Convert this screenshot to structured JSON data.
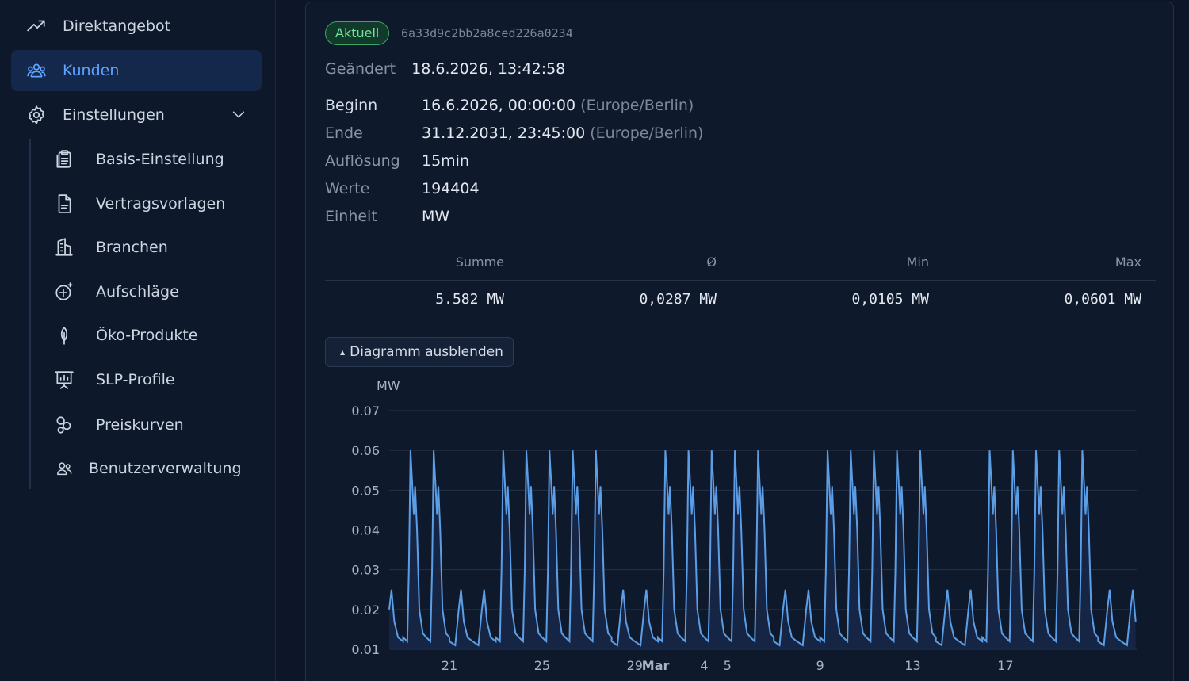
{
  "sidebar": {
    "items": [
      {
        "label": "Direktangebot",
        "icon": "trending-up-icon"
      },
      {
        "label": "Kunden",
        "icon": "users-icon",
        "active": true
      },
      {
        "label": "Einstellungen",
        "icon": "gear-icon",
        "expanded": true
      }
    ],
    "subitems": [
      {
        "label": "Basis-Einstellung",
        "icon": "clipboard-icon"
      },
      {
        "label": "Vertragsvorlagen",
        "icon": "document-icon"
      },
      {
        "label": "Branchen",
        "icon": "building-icon"
      },
      {
        "label": "Aufschläge",
        "icon": "plus-circle-icon"
      },
      {
        "label": "Öko-Produkte",
        "icon": "leaf-icon"
      },
      {
        "label": "SLP-Profile",
        "icon": "presentation-chart-icon"
      },
      {
        "label": "Preiskurven",
        "icon": "circles-icon"
      },
      {
        "label": "Benutzerverwaltung",
        "icon": "user-group-icon"
      }
    ]
  },
  "detail": {
    "badge": "Aktuell",
    "hash": "6a33d9c2bb2a8ced226a0234",
    "changed_label": "Geändert",
    "changed_value": "18.6.2026, 13:42:58",
    "fields": [
      {
        "label": "Beginn",
        "value": "16.6.2026, 00:00:00",
        "suffix": "(Europe/Berlin)"
      },
      {
        "label": "Ende",
        "value": "31.12.2031, 23:45:00",
        "suffix": "(Europe/Berlin)"
      },
      {
        "label": "Auflösung",
        "value": "15min",
        "suffix": ""
      },
      {
        "label": "Werte",
        "value": "194404",
        "suffix": ""
      },
      {
        "label": "Einheit",
        "value": "MW",
        "suffix": ""
      }
    ],
    "stats": {
      "headers": [
        "Summe",
        "Ø",
        "Min",
        "Max"
      ],
      "values": [
        "5.582 MW",
        "0,0287 MW",
        "0,0105 MW",
        "0,0601 MW"
      ]
    },
    "toggle_label": "Diagramm ausblenden"
  },
  "colors": {
    "line": "#5b9ee6",
    "fill": "#16284a",
    "grid": "#263248"
  },
  "chart_data": {
    "type": "area",
    "ylabel": "MW",
    "ylim": [
      0.01,
      0.07
    ],
    "yticks": [
      0.01,
      0.02,
      0.03,
      0.04,
      0.05,
      0.06,
      0.07
    ],
    "xlim": [
      18.4,
      50.7
    ],
    "xticks": [
      {
        "label": "21",
        "day": 21
      },
      {
        "label": "25",
        "day": 25
      },
      {
        "label": "29",
        "day": 29
      },
      {
        "label": "Mar",
        "day": 29.9,
        "bold": true
      },
      {
        "label": "4",
        "day": 32
      },
      {
        "label": "5",
        "day": 33
      },
      {
        "label": "9",
        "day": 37
      },
      {
        "label": "13",
        "day": 41
      },
      {
        "label": "17",
        "day": 45
      }
    ],
    "x_unit": "days (Feb/Mar)",
    "series": [
      {
        "daily_pattern": [
          {
            "day": 18,
            "kind": "weekend"
          },
          {
            "day": 19,
            "kind": "weekday"
          },
          {
            "day": 20,
            "kind": "weekday"
          },
          {
            "day": 21,
            "kind": "weekend"
          },
          {
            "day": 22,
            "kind": "weekend"
          },
          {
            "day": 23,
            "kind": "weekday"
          },
          {
            "day": 24,
            "kind": "weekday"
          },
          {
            "day": 25,
            "kind": "weekday"
          },
          {
            "day": 26,
            "kind": "weekday"
          },
          {
            "day": 27,
            "kind": "weekday"
          },
          {
            "day": 28,
            "kind": "weekend"
          },
          {
            "day": 29,
            "kind": "weekend"
          },
          {
            "day": 30,
            "kind": "weekday"
          },
          {
            "day": 31,
            "kind": "weekday"
          },
          {
            "day": 32,
            "kind": "weekday"
          },
          {
            "day": 33,
            "kind": "weekday"
          },
          {
            "day": 34,
            "kind": "weekday"
          },
          {
            "day": 35,
            "kind": "weekend"
          },
          {
            "day": 36,
            "kind": "weekend"
          },
          {
            "day": 37,
            "kind": "weekday"
          },
          {
            "day": 38,
            "kind": "weekday"
          },
          {
            "day": 39,
            "kind": "weekday"
          },
          {
            "day": 40,
            "kind": "weekday"
          },
          {
            "day": 41,
            "kind": "weekday"
          },
          {
            "day": 42,
            "kind": "weekend"
          },
          {
            "day": 43,
            "kind": "weekend"
          },
          {
            "day": 44,
            "kind": "weekday"
          },
          {
            "day": 45,
            "kind": "weekday"
          },
          {
            "day": 46,
            "kind": "weekday"
          },
          {
            "day": 47,
            "kind": "weekday"
          },
          {
            "day": 48,
            "kind": "weekday"
          },
          {
            "day": 49,
            "kind": "weekend"
          },
          {
            "day": 50,
            "kind": "weekend"
          }
        ],
        "weekday_peak": 0.06,
        "weekday_mid": 0.051,
        "weekday_low": 0.044,
        "weekend_peak": 0.025,
        "weekend_low": 0.011
      }
    ]
  }
}
